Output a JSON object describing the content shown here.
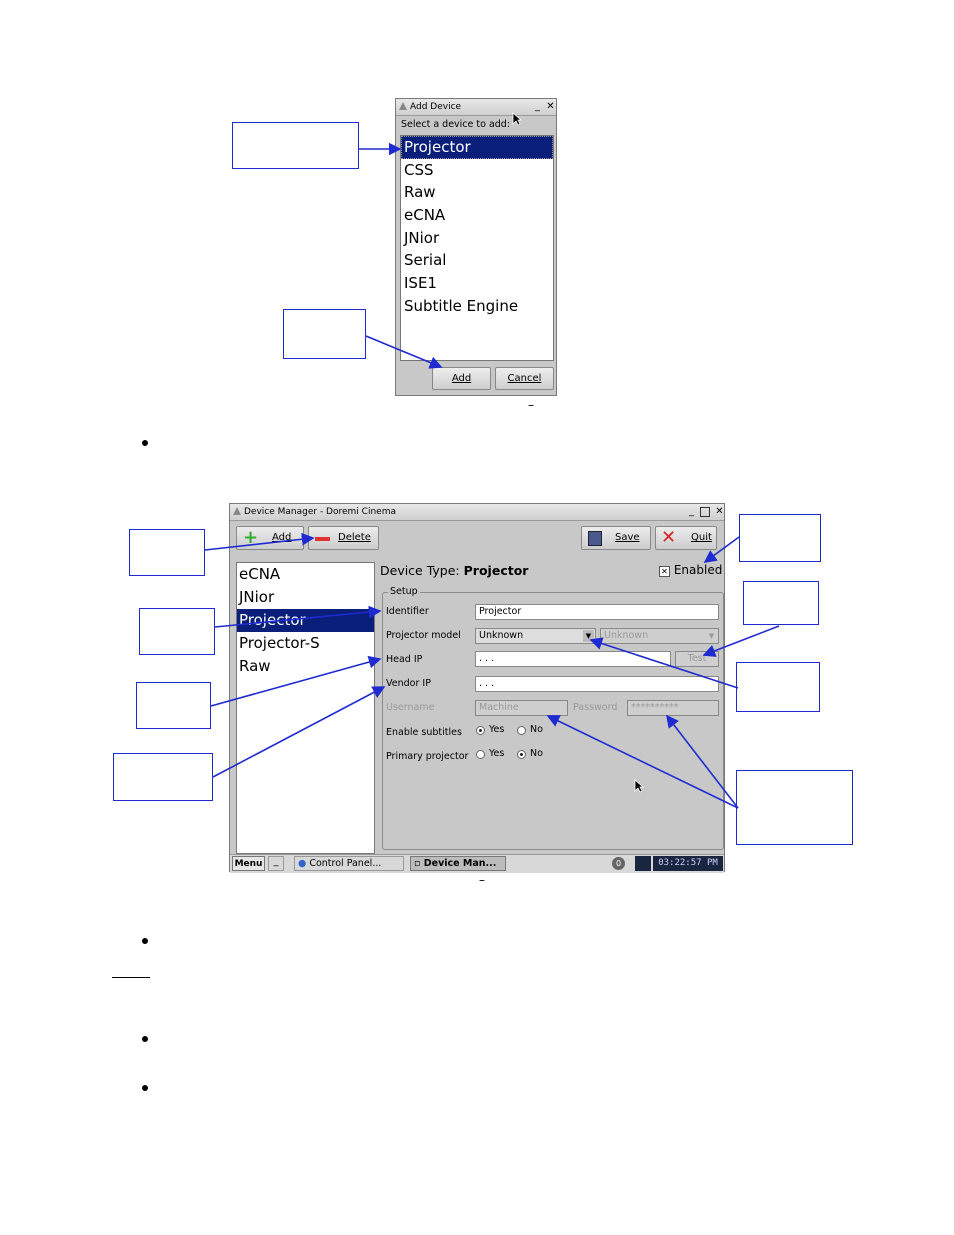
{
  "add_device": {
    "title": "Add Device",
    "prompt": "Select a device to add:",
    "items": [
      "Projector",
      "CSS",
      "Raw",
      "eCNA",
      "JNior",
      "Serial",
      "ISE1",
      "Subtitle Engine"
    ],
    "selected": "Projector",
    "add_label": "Add",
    "cancel_label": "Cancel",
    "caption_dash": "–"
  },
  "device_manager": {
    "title": "Device Manager - Doremi Cinema",
    "toolbar": {
      "add": "Add",
      "delete": "Delete",
      "save": "Save",
      "quit": "Quit"
    },
    "devices": [
      "eCNA",
      "JNior",
      "Projector",
      "Projector-S",
      "Raw"
    ],
    "selected": "Projector",
    "device_type_label": "Device Type:",
    "device_type_value": "Projector",
    "enabled_label": "Enabled",
    "setup_legend": "Setup",
    "fields": {
      "identifier_label": "Identifier",
      "identifier_value": "Projector",
      "model_label": "Projector model",
      "model_value": "Unknown",
      "model2_value": "Unknown",
      "head_ip_label": "Head IP",
      "head_ip_value": ". . .",
      "test_label": "Test",
      "vendor_ip_label": "Vendor IP",
      "vendor_ip_value": ". . .",
      "username_label": "Username",
      "username_value": "Machine",
      "password_label": "Password",
      "password_value": "**********",
      "subtitles_label": "Enable subtitles",
      "primary_label": "Primary projector",
      "yes": "Yes",
      "no": "No"
    },
    "taskbar": {
      "menu": "Menu",
      "task1": "Control Panel...",
      "task2": "Device Man...",
      "notif": "0",
      "clock": "03:22:57 PM"
    },
    "caption_dash": "–"
  },
  "colors": {
    "selection": "#0a1f7a",
    "callout": "#1f2bd0"
  }
}
